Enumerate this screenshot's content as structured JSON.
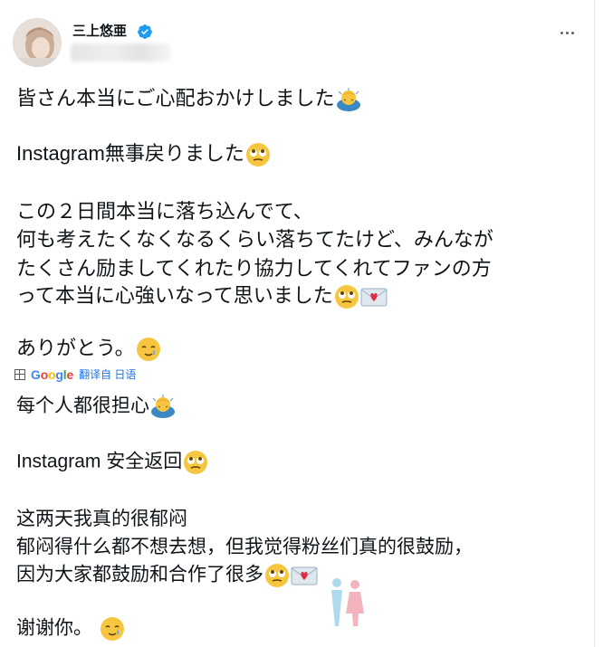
{
  "author": {
    "name": "三上悠亜",
    "verified_icon": "verified-badge-icon",
    "handle": "",
    "avatar_icon": "avatar-photo"
  },
  "more_icon": "more-horizontal-icon",
  "original": {
    "line1": "皆さん本当にご心配おかけしました",
    "line2": "Instagram無事戻りました",
    "line3": "この２日間本当に落ち込んでて、",
    "line4": "何も考えたくなくなるくらい落ちてたけど、みんなが",
    "line5": "たくさん励ましてくれたり協力してくれてファンの方",
    "line6": "って本当に心強いなって思いました",
    "line7": "ありがとう。"
  },
  "translate_bar": {
    "google_label": "Google",
    "text": "翻译自 日语"
  },
  "translated": {
    "line1": "每个人都很担心",
    "line2": " Instagram 安全返回",
    "line3": "这两天我真的很郁闷",
    "line4": "郁闷得什么都不想去想，但我觉得粉丝们真的很鼓励，",
    "line5": "因为大家都鼓励和合作了很多",
    "line6": "谢谢你。"
  },
  "colors": {
    "text": "#0f1419",
    "verified": "#1d9bf0",
    "translate_link": "#1a73e8",
    "emoji_face": "#f7c640"
  }
}
